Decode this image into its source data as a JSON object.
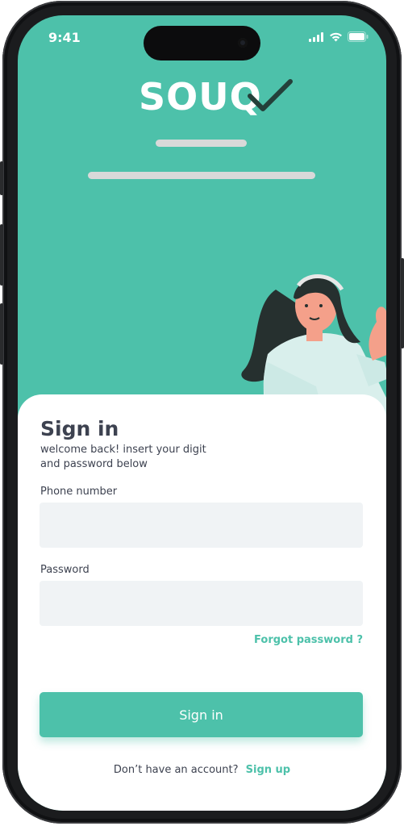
{
  "status_bar": {
    "time": "9:41"
  },
  "brand": {
    "name": "SOUQ",
    "accent_color": "#4dc1aa",
    "dark_color": "#24403a"
  },
  "sign_in": {
    "title": "Sign in",
    "subtitle_line1": "welcome back! insert your digit",
    "subtitle_line2": "and password below",
    "phone_label": "Phone number",
    "phone_value": "",
    "password_label": "Password",
    "password_value": "",
    "forgot_password": "Forgot password ?",
    "submit_label": "Sign in",
    "no_account_text": "Don’t have an account?",
    "signup_link": "Sign up"
  },
  "icons": [
    "signal-icon",
    "wifi-icon",
    "battery-icon",
    "checkmark-icon"
  ]
}
